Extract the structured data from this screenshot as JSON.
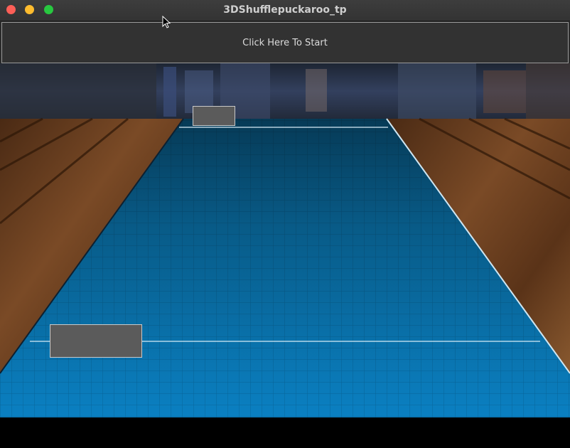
{
  "window": {
    "title": "3DShufflepuckaroo_tp"
  },
  "toolbar": {
    "start_label": "Click Here To Start"
  },
  "colors": {
    "table_surface": "#0a77b4",
    "table_far": "#063d59",
    "wood": "#6b3f1f",
    "background_top": "#2e3a55"
  },
  "icons": {
    "cursor": "mouse-cursor-icon",
    "close": "close-icon",
    "minimize": "minimize-icon",
    "maximize": "maximize-icon"
  }
}
